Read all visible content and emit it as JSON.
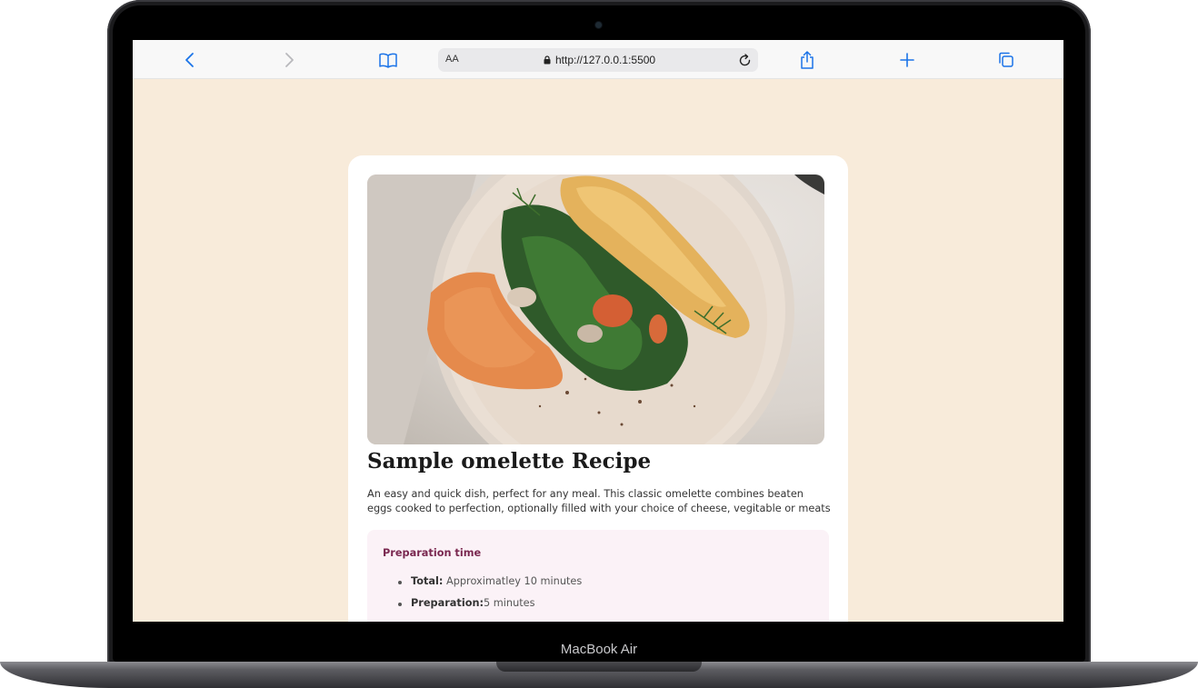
{
  "device": {
    "label": "MacBook Air"
  },
  "browser": {
    "text_size_label": "AA",
    "url": "http://127.0.0.1:5500",
    "icons": [
      "back-icon",
      "forward-icon",
      "bookmarks-icon",
      "lock-icon",
      "reload-icon",
      "share-icon",
      "new-tab-icon",
      "tabs-icon"
    ]
  },
  "page": {
    "background_color": "#f8ebda",
    "image_alt": "Omelette with spinach, mushrooms, salmon and dill on a plate",
    "title": "Sample omelette Recipe",
    "description": "An easy and quick dish, perfect for any meal. This classic omelette combines beaten eggs cooked to perfection, optionally filled with your choice of cheese, vegitable or meats",
    "preparation": {
      "heading": "Preparation time",
      "items": [
        {
          "label": "Total:",
          "value": " Approximatley 10 minutes"
        },
        {
          "label": "Preparation:",
          "value": "5 minutes"
        }
      ]
    }
  }
}
